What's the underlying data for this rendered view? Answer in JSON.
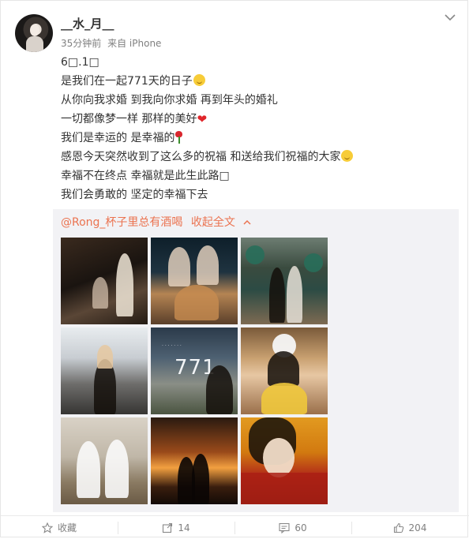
{
  "post": {
    "username": "__水_月__",
    "time": "35分钟前",
    "source": "来自 iPhone",
    "lines": [
      "6□.1□",
      "是我们在一起771天的日子",
      "从你向我求婚 到我向你求婚 再到年头的婚礼",
      "一切都像梦一样 那样的美好",
      "我们是幸运的 是幸福的",
      "感恩今天突然收到了这么多的祝福 和送给我们祝福的大家",
      "幸福不在终点 幸福就是此生此路□",
      "我们会勇敢的 坚定的幸福下去"
    ]
  },
  "repost": {
    "mention": "@Rong_杯子里总有酒喝",
    "collapse_label": "收起全文"
  },
  "photos": {
    "p5_number": "771",
    "p5_caption": "· · · · · · ·"
  },
  "footer": {
    "favorite_label": "收藏",
    "repost_count": "14",
    "comment_count": "60",
    "like_count": "204"
  },
  "colors": {
    "accent": "#eb7350",
    "meta": "#808080"
  }
}
